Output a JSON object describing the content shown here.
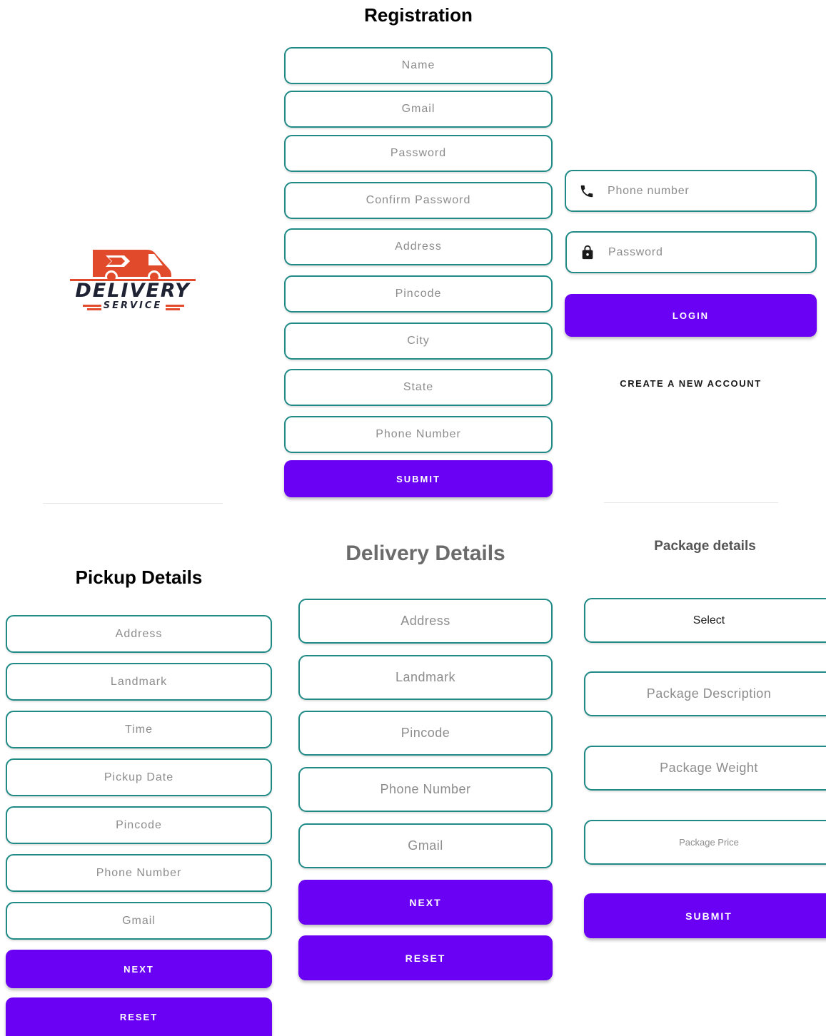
{
  "logo": {
    "line1": "DELIVERY",
    "line2": "SERVICE",
    "brand_color": "#e24a2c",
    "ink_color": "#1e2233"
  },
  "registration": {
    "title": "Registration",
    "fields": [
      "Name",
      "Gmail",
      "Password",
      "Confirm Password",
      "Address",
      "Pincode",
      "City",
      "State",
      "Phone Number"
    ],
    "submit_label": "SUBMIT"
  },
  "login": {
    "phone_placeholder": "Phone number",
    "phone_icon": "phone-icon",
    "password_placeholder": "Password",
    "password_icon": "lock-icon",
    "login_label": "LOGIN",
    "create_account_label": "CREATE A NEW ACCOUNT"
  },
  "pickup": {
    "title": "Pickup Details",
    "fields": [
      "Address",
      "Landmark",
      "Time",
      "Pickup Date",
      "Pincode",
      "Phone Number",
      "Gmail"
    ],
    "next_label": "NEXT",
    "reset_label": "RESET"
  },
  "delivery": {
    "title": "Delivery Details",
    "fields": [
      "Address",
      "Landmark",
      "Pincode",
      "Phone Number",
      "Gmail"
    ],
    "next_label": "NEXT",
    "reset_label": "RESET"
  },
  "package": {
    "title": "Package details",
    "select_label": "Select",
    "description_placeholder": "Package Description",
    "weight_placeholder": "Package Weight",
    "price_placeholder": "Package Price",
    "submit_label": "SUBMIT"
  },
  "colors": {
    "accent": "#6a00f4",
    "field_border": "#1f8a86",
    "placeholder": "#8c8c8c"
  }
}
